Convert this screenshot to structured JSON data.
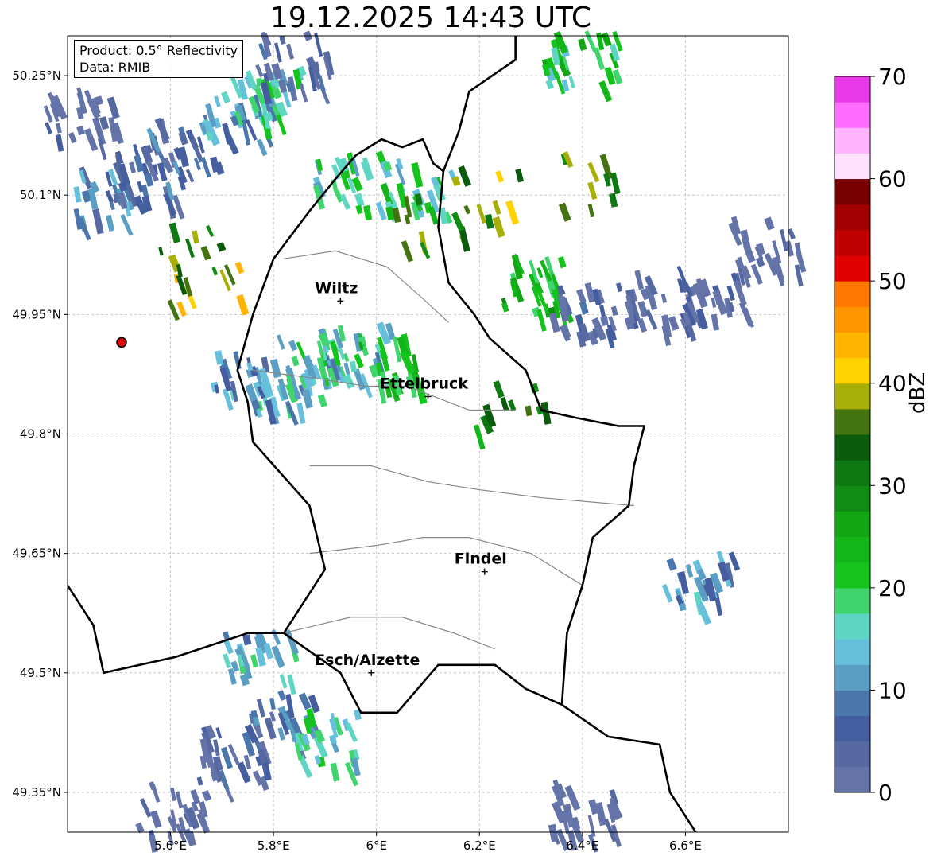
{
  "title": "19.12.2025 14:43 UTC",
  "info": {
    "product": "Product: 0.5° Reflectivity",
    "data": "Data: RMIB"
  },
  "axes": {
    "lon_min": 5.4,
    "lon_max": 6.8,
    "lat_min": 49.3,
    "lat_max": 50.3,
    "x_ticks": [
      5.6,
      5.8,
      6.0,
      6.2,
      6.4,
      6.6
    ],
    "x_tick_labels": [
      "5.6°E",
      "5.8°E",
      "6°E",
      "6.2°E",
      "6.4°E",
      "6.6°E"
    ],
    "y_ticks": [
      49.35,
      49.5,
      49.65,
      49.8,
      49.95,
      50.1,
      50.25
    ],
    "y_tick_labels": [
      "49.35°N",
      "49.5°N",
      "49.65°N",
      "49.8°N",
      "49.95°N",
      "50.1°N",
      "50.25°N"
    ],
    "grid": true
  },
  "cities": [
    {
      "name": "Wiltz",
      "lon": 5.93,
      "lat": 49.967
    },
    {
      "name": "Ettelbruck",
      "lon": 6.1,
      "lat": 49.847
    },
    {
      "name": "Findel",
      "lon": 6.21,
      "lat": 49.627
    },
    {
      "name": "Esch/Alzette",
      "lon": 5.99,
      "lat": 49.5
    }
  ],
  "radar_site": {
    "lon": 5.505,
    "lat": 49.915
  },
  "colorbar": {
    "label": "dBZ",
    "min": 0,
    "max": 70,
    "ticks": [
      0,
      10,
      20,
      30,
      40,
      50,
      60,
      70
    ],
    "colors": [
      "#6474a8",
      "#5669a0",
      "#455e9f",
      "#4a76ac",
      "#5a9ec4",
      "#66c0dc",
      "#5fd6c4",
      "#3fd46c",
      "#14c41c",
      "#13b618",
      "#12a614",
      "#108c12",
      "#0e7812",
      "#0a5c0c",
      "#437410",
      "#a8b008",
      "#ffd200",
      "#ffb400",
      "#ff9600",
      "#ff7800",
      "#e00000",
      "#c00000",
      "#a00000",
      "#780000",
      "#ffe0ff",
      "#ffb4ff",
      "#ff6cff",
      "#e838e8"
    ]
  },
  "chart_data": {
    "type": "heatmap",
    "title": "19.12.2025 14:43 UTC",
    "value_label": "dBZ",
    "xlim": [
      5.4,
      6.8
    ],
    "ylim": [
      49.3,
      50.3
    ],
    "cells": [
      {
        "lon": 5.48,
        "lat": 50.1,
        "dbz": 14
      },
      {
        "lon": 5.55,
        "lat": 50.13,
        "dbz": 12
      },
      {
        "lon": 5.62,
        "lat": 50.16,
        "dbz": 11
      },
      {
        "lon": 5.72,
        "lat": 50.2,
        "dbz": 18
      },
      {
        "lon": 5.78,
        "lat": 50.23,
        "dbz": 22
      },
      {
        "lon": 5.83,
        "lat": 50.27,
        "dbz": 10
      },
      {
        "lon": 5.42,
        "lat": 50.2,
        "dbz": 8
      },
      {
        "lon": 5.66,
        "lat": 49.99,
        "dbz": 44
      },
      {
        "lon": 5.63,
        "lat": 50.03,
        "dbz": 40
      },
      {
        "lon": 5.93,
        "lat": 50.12,
        "dbz": 22
      },
      {
        "lon": 6.07,
        "lat": 50.11,
        "dbz": 24
      },
      {
        "lon": 6.1,
        "lat": 50.07,
        "dbz": 40
      },
      {
        "lon": 6.21,
        "lat": 50.1,
        "dbz": 42
      },
      {
        "lon": 6.41,
        "lat": 50.12,
        "dbz": 40
      },
      {
        "lon": 6.39,
        "lat": 50.27,
        "dbz": 26
      },
      {
        "lon": 6.31,
        "lat": 49.99,
        "dbz": 30
      },
      {
        "lon": 6.65,
        "lat": 49.98,
        "dbz": 8
      },
      {
        "lon": 6.75,
        "lat": 50.04,
        "dbz": 6
      },
      {
        "lon": 6.55,
        "lat": 49.97,
        "dbz": 7
      },
      {
        "lon": 6.4,
        "lat": 49.96,
        "dbz": 8
      },
      {
        "lon": 5.82,
        "lat": 49.86,
        "dbz": 20
      },
      {
        "lon": 5.87,
        "lat": 49.89,
        "dbz": 22
      },
      {
        "lon": 5.95,
        "lat": 49.91,
        "dbz": 21
      },
      {
        "lon": 6.01,
        "lat": 49.89,
        "dbz": 26
      },
      {
        "lon": 5.74,
        "lat": 49.87,
        "dbz": 16
      },
      {
        "lon": 6.25,
        "lat": 49.83,
        "dbz": 36
      },
      {
        "lon": 5.8,
        "lat": 49.45,
        "dbz": 12
      },
      {
        "lon": 5.72,
        "lat": 49.4,
        "dbz": 8
      },
      {
        "lon": 5.6,
        "lat": 49.33,
        "dbz": 6
      },
      {
        "lon": 5.9,
        "lat": 49.42,
        "dbz": 22
      },
      {
        "lon": 5.77,
        "lat": 49.52,
        "dbz": 19
      },
      {
        "lon": 6.4,
        "lat": 49.33,
        "dbz": 4
      },
      {
        "lon": 6.62,
        "lat": 49.62,
        "dbz": 16
      }
    ]
  }
}
